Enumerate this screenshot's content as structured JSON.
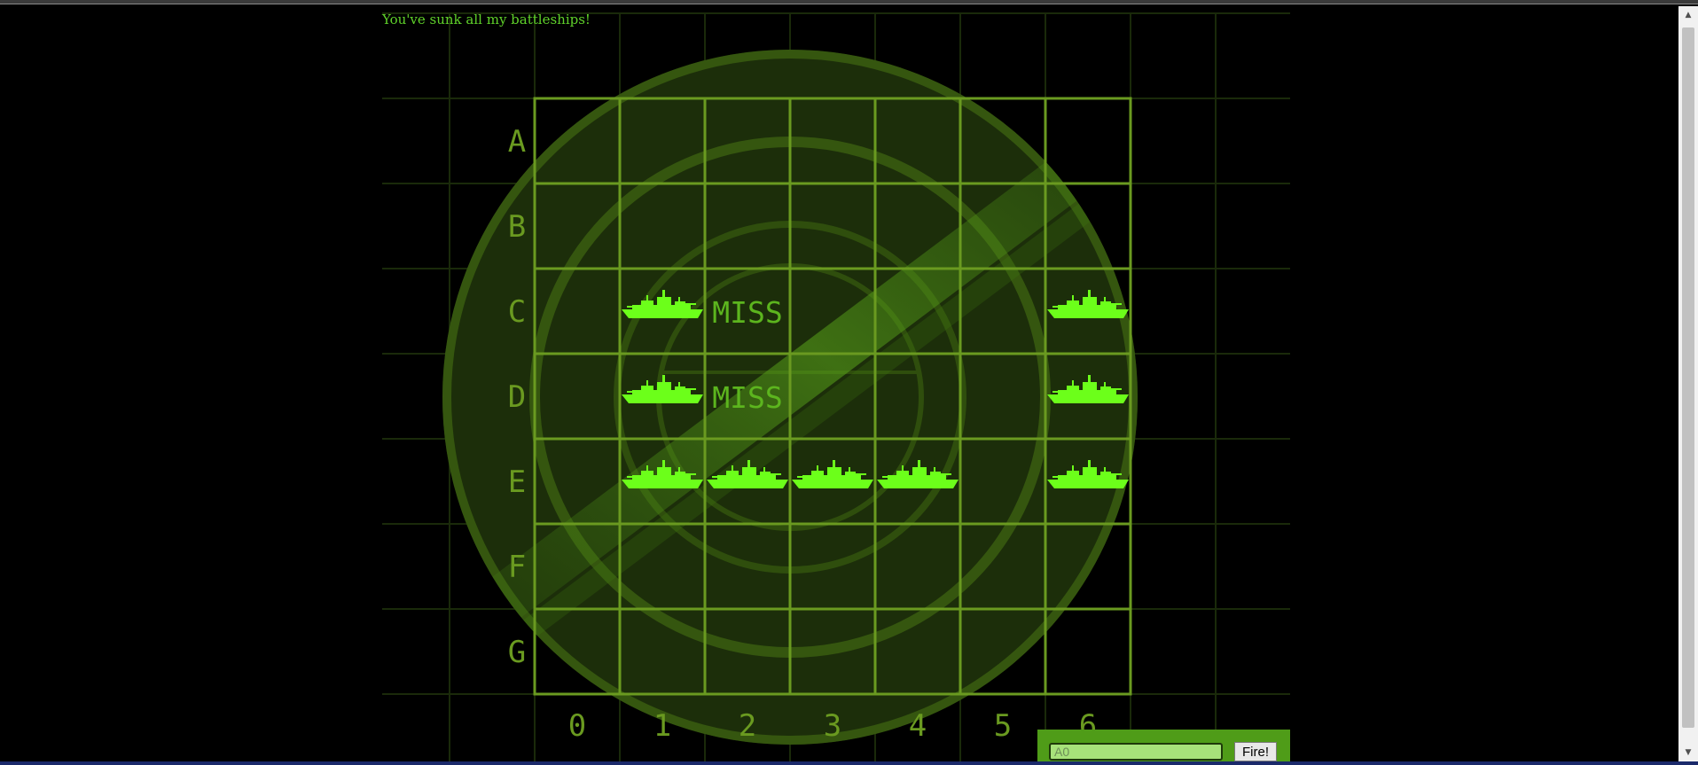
{
  "message": "You've sunk all my battleships!",
  "board": {
    "rows": [
      "A",
      "B",
      "C",
      "D",
      "E",
      "F",
      "G"
    ],
    "cols": [
      "0",
      "1",
      "2",
      "3",
      "4",
      "5",
      "6"
    ],
    "hits": [
      "C1",
      "C6",
      "D1",
      "D6",
      "E1",
      "E2",
      "E3",
      "E4",
      "E6"
    ],
    "misses": [
      "C2",
      "D2"
    ],
    "miss_label": "MISS"
  },
  "form": {
    "placeholder": "A0",
    "fire_label": "Fire!"
  },
  "colors": {
    "accent": "#5fd12a",
    "ship": "#6cff1a",
    "grid": "#6a9a20",
    "radar_fill": "#1c2e0a"
  },
  "icons": {
    "ship": "battleship-icon",
    "scroll_up": "arrow-up-icon",
    "scroll_down": "arrow-down-icon"
  }
}
